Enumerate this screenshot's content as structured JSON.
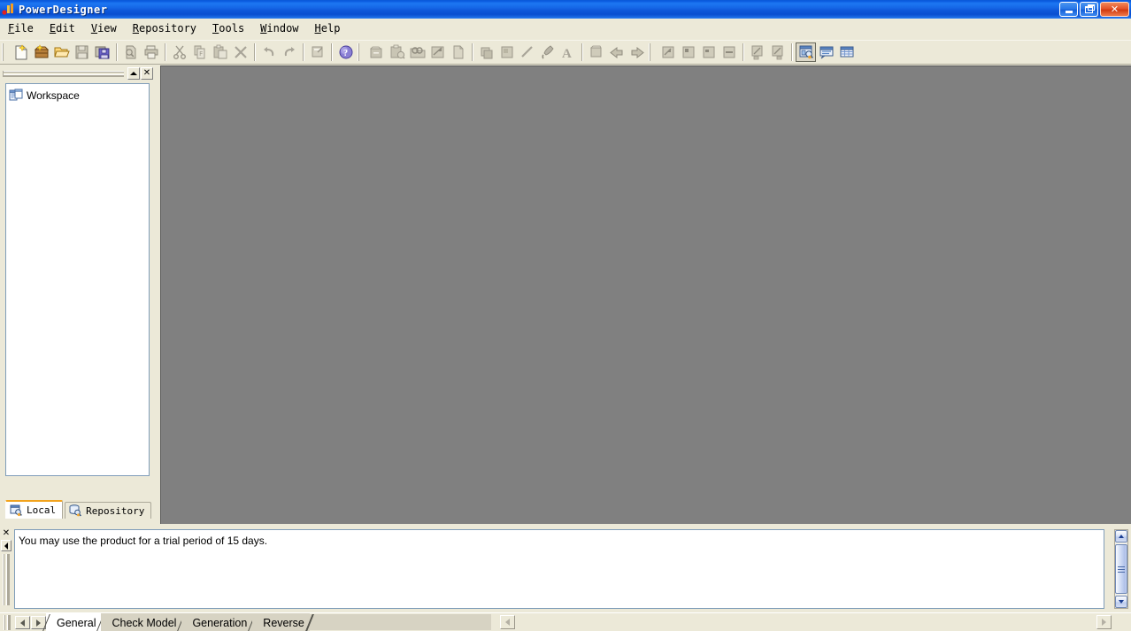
{
  "window": {
    "title": "PowerDesigner",
    "app_icon": "powerdesigner-logo-icon",
    "buttons": {
      "minimize": "minimize-button",
      "restore": "restore-button",
      "close": "close-button"
    },
    "colors": {
      "titlebar_blue": "#1567e6",
      "close_red": "#d03a10",
      "face": "#ece9d8",
      "mdi_background": "#808080",
      "active_tab_accent": "#f2a31d"
    }
  },
  "menubar": {
    "items": [
      {
        "label": "File",
        "accel": "F"
      },
      {
        "label": "Edit",
        "accel": "E"
      },
      {
        "label": "View",
        "accel": "V"
      },
      {
        "label": "Repository",
        "accel": "R"
      },
      {
        "label": "Tools",
        "accel": "T"
      },
      {
        "label": "Window",
        "accel": "W"
      },
      {
        "label": "Help",
        "accel": "H"
      }
    ]
  },
  "toolbar": {
    "groups": [
      {
        "name": "standard-file",
        "buttons": [
          {
            "icon": "new-document-icon",
            "label": "New Model",
            "enabled": true,
            "pressed": false
          },
          {
            "icon": "new-package-icon",
            "label": "New Package",
            "enabled": true,
            "pressed": false
          },
          {
            "icon": "open-folder-icon",
            "label": "Open Model",
            "enabled": true,
            "pressed": false
          },
          {
            "icon": "save-icon",
            "label": "Save",
            "enabled": false,
            "pressed": false
          },
          {
            "icon": "save-all-icon",
            "label": "Save All",
            "enabled": true,
            "pressed": false
          }
        ]
      },
      {
        "name": "print",
        "buttons": [
          {
            "icon": "print-preview-icon",
            "label": "Print Preview",
            "enabled": false,
            "pressed": false
          },
          {
            "icon": "print-icon",
            "label": "Print",
            "enabled": true,
            "pressed": false
          }
        ]
      },
      {
        "name": "clipboard",
        "buttons": [
          {
            "icon": "cut-icon",
            "label": "Cut",
            "enabled": false,
            "pressed": false
          },
          {
            "icon": "copy-icon",
            "label": "Copy",
            "enabled": false,
            "pressed": false
          },
          {
            "icon": "paste-icon",
            "label": "Paste",
            "enabled": false,
            "pressed": false
          },
          {
            "icon": "delete-icon",
            "label": "Delete",
            "enabled": false,
            "pressed": false
          }
        ]
      },
      {
        "name": "history",
        "buttons": [
          {
            "icon": "undo-icon",
            "label": "Undo",
            "enabled": false,
            "pressed": false
          },
          {
            "icon": "redo-icon",
            "label": "Redo",
            "enabled": false,
            "pressed": false
          }
        ]
      },
      {
        "name": "properties",
        "buttons": [
          {
            "icon": "properties-icon",
            "label": "Properties",
            "enabled": false,
            "pressed": false
          }
        ]
      },
      {
        "name": "help",
        "buttons": [
          {
            "icon": "help-icon",
            "label": "Help",
            "enabled": true,
            "pressed": false
          }
        ]
      },
      {
        "name": "model-tools",
        "buttons": [
          {
            "icon": "model-properties-icon",
            "label": "Model Properties",
            "enabled": false,
            "pressed": false
          },
          {
            "icon": "check-model-icon",
            "label": "Check Model",
            "enabled": false,
            "pressed": false
          },
          {
            "icon": "find-objects-icon",
            "label": "Find Objects",
            "enabled": false,
            "pressed": false
          },
          {
            "icon": "display-preferences-icon",
            "label": "Display Preferences",
            "enabled": false,
            "pressed": false
          },
          {
            "icon": "report-icon",
            "label": "Report",
            "enabled": false,
            "pressed": false
          }
        ]
      },
      {
        "name": "format",
        "buttons": [
          {
            "icon": "symbol-format-icon",
            "label": "Symbol Format",
            "enabled": false,
            "pressed": false
          },
          {
            "icon": "fill-style-icon",
            "label": "Fill Style",
            "enabled": false,
            "pressed": false
          },
          {
            "icon": "line-style-icon",
            "label": "Line Style",
            "enabled": false,
            "pressed": false
          },
          {
            "icon": "format-painter-icon",
            "label": "Format Painter",
            "enabled": false,
            "pressed": false
          },
          {
            "icon": "font-icon",
            "label": "Font",
            "enabled": false,
            "pressed": false
          }
        ]
      },
      {
        "name": "navigate",
        "buttons": [
          {
            "icon": "open-diagram-icon",
            "label": "Open Diagram",
            "enabled": false,
            "pressed": false
          },
          {
            "icon": "back-icon",
            "label": "Back",
            "enabled": false,
            "pressed": false
          },
          {
            "icon": "forward-icon",
            "label": "Forward",
            "enabled": false,
            "pressed": false
          }
        ]
      },
      {
        "name": "zoom",
        "buttons": [
          {
            "icon": "zoom-in-icon",
            "label": "Zoom In",
            "enabled": false,
            "pressed": false
          },
          {
            "icon": "zoom-out-icon",
            "label": "Zoom Out",
            "enabled": false,
            "pressed": false
          },
          {
            "icon": "zoom-page-icon",
            "label": "Whole Page",
            "enabled": false,
            "pressed": false
          },
          {
            "icon": "zoom-width-icon",
            "label": "Page Width",
            "enabled": false,
            "pressed": false
          }
        ]
      },
      {
        "name": "align",
        "buttons": [
          {
            "icon": "align-left-icon",
            "label": "Align Left",
            "enabled": false,
            "pressed": false
          },
          {
            "icon": "align-right-icon",
            "label": "Align Right",
            "enabled": false,
            "pressed": false
          }
        ]
      },
      {
        "name": "views",
        "buttons": [
          {
            "icon": "browser-window-icon",
            "label": "Browser",
            "enabled": true,
            "pressed": true
          },
          {
            "icon": "output-window-icon",
            "label": "Output",
            "enabled": true,
            "pressed": false
          },
          {
            "icon": "result-list-icon",
            "label": "Result List",
            "enabled": true,
            "pressed": false
          }
        ]
      }
    ]
  },
  "browser": {
    "caption_buttons": {
      "rollup": "rollup-button",
      "close": "close-button"
    },
    "tree": [
      {
        "label": "Workspace",
        "icon": "workspace-icon"
      }
    ],
    "tabs": [
      {
        "label": "Local",
        "icon": "local-browser-icon",
        "active": true
      },
      {
        "label": "Repository",
        "icon": "repository-browser-icon",
        "active": false
      }
    ]
  },
  "output": {
    "close_button": "close-button",
    "collapse_button": "collapse-button",
    "lines": [
      "You may use the product for a trial period of 15 days."
    ],
    "scrollbar": {
      "up": "scroll-up-button",
      "down": "scroll-down-button",
      "thumb": "scroll-thumb"
    }
  },
  "bottom_tabs": {
    "nav": {
      "prev": "previous-tab-button",
      "next": "next-tab-button"
    },
    "items": [
      {
        "label": "General",
        "active": true
      },
      {
        "label": "Check Model",
        "active": false
      },
      {
        "label": "Generation",
        "active": false
      },
      {
        "label": "Reverse",
        "active": false
      }
    ],
    "hscroll": {
      "left": "scroll-left-button",
      "right": "scroll-right-button"
    }
  }
}
